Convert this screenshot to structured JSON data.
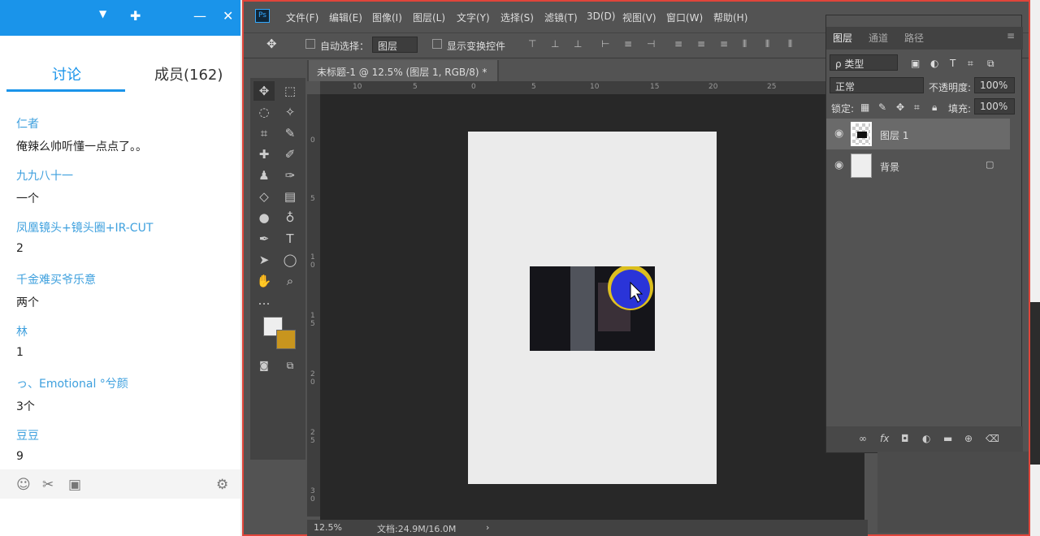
{
  "chat": {
    "tab_discuss": "讨论",
    "tab_members": "成员(162)",
    "messages": [
      {
        "name": "仁者",
        "text": "俺辣么帅听懂一点点了。。"
      },
      {
        "name": "九九八十一",
        "text": "一个"
      },
      {
        "name": "凤凰镜头+镜头圈+IR-CUT",
        "text": "2"
      },
      {
        "name": "千金难买爷乐意",
        "text": "两个"
      },
      {
        "name": "林",
        "text": "1"
      },
      {
        "name": "っ、Emotional °兮颜",
        "text": "3个"
      },
      {
        "name": "豆豆",
        "text": "9"
      }
    ],
    "icons": [
      "emoji-icon",
      "scissors-icon",
      "image-icon",
      "gear-icon"
    ]
  },
  "ps": {
    "logo": "Ps",
    "menu": [
      "文件(F)",
      "编辑(E)",
      "图像(I)",
      "图层(L)",
      "文字(Y)",
      "选择(S)",
      "滤镜(T)",
      "3D(D)",
      "视图(V)",
      "窗口(W)",
      "帮助(H)"
    ],
    "options": {
      "auto_select": "自动选择：",
      "auto_select_value": "图层",
      "show_transform": "显示变换控件"
    },
    "doc_tab": "未标题-1 @ 12.5% (图层 1, RGB/8) *",
    "ruler_h": [
      "10",
      "5",
      "0",
      "5",
      "10",
      "15",
      "20",
      "25"
    ],
    "ruler_v": [
      "0",
      "5",
      "1 0",
      "1 5",
      "2 0",
      "2 5",
      "3 0"
    ],
    "zoom": "12.5%",
    "doc_info": "文档:24.9M/16.0M"
  },
  "layers": {
    "tabs": [
      "图层",
      "通道",
      "路径"
    ],
    "filter": "ρ 类型",
    "blend": "正常",
    "opacity_label": "不透明度:",
    "opacity": "100%",
    "lock_label": "锁定:",
    "fill_label": "填充:",
    "fill": "100%",
    "items": [
      "图层 1",
      "背景"
    ]
  }
}
